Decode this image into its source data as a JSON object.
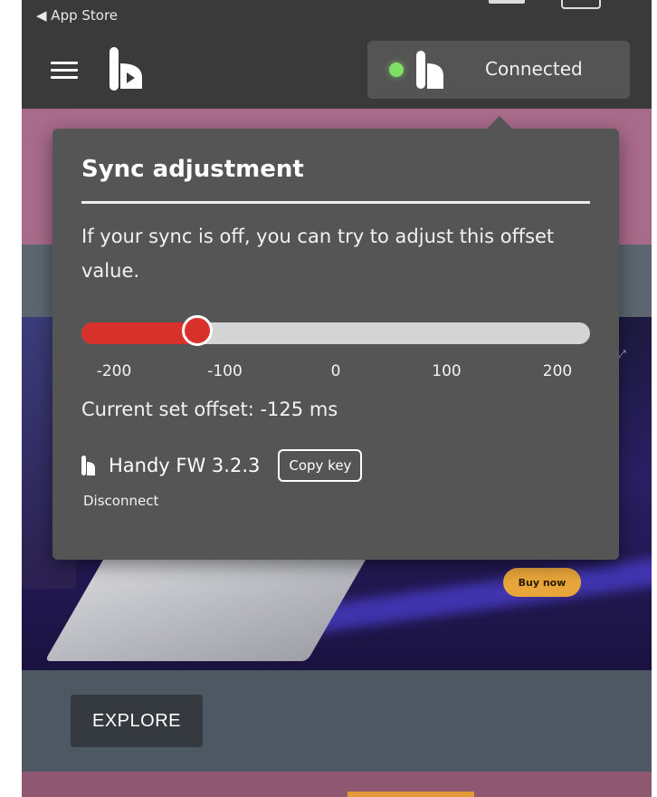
{
  "status_bar": {
    "back_label": "◀ App Store"
  },
  "header": {
    "menu_icon": "hamburger-icon",
    "logo_icon": "handy-logo-icon",
    "connection": {
      "status_text": "Connected",
      "indicator_color": "#7fe066"
    }
  },
  "promo": {
    "buy_label": "Buy now"
  },
  "page": {
    "explore_label": "EXPLORE"
  },
  "sync_popover": {
    "title": "Sync adjustment",
    "description": "If your sync is off, you can try to adjust this offset value.",
    "slider": {
      "min": -200,
      "max": 200,
      "value": -125,
      "fill_color": "#d8302b"
    },
    "tick_labels": [
      "-200",
      "-100",
      "0",
      "100",
      "200"
    ],
    "current_offset_text": "Current set offset: -125 ms",
    "device_name": "Handy FW 3.2.3",
    "copy_key_label": "Copy key",
    "disconnect_label": "Disconnect"
  }
}
